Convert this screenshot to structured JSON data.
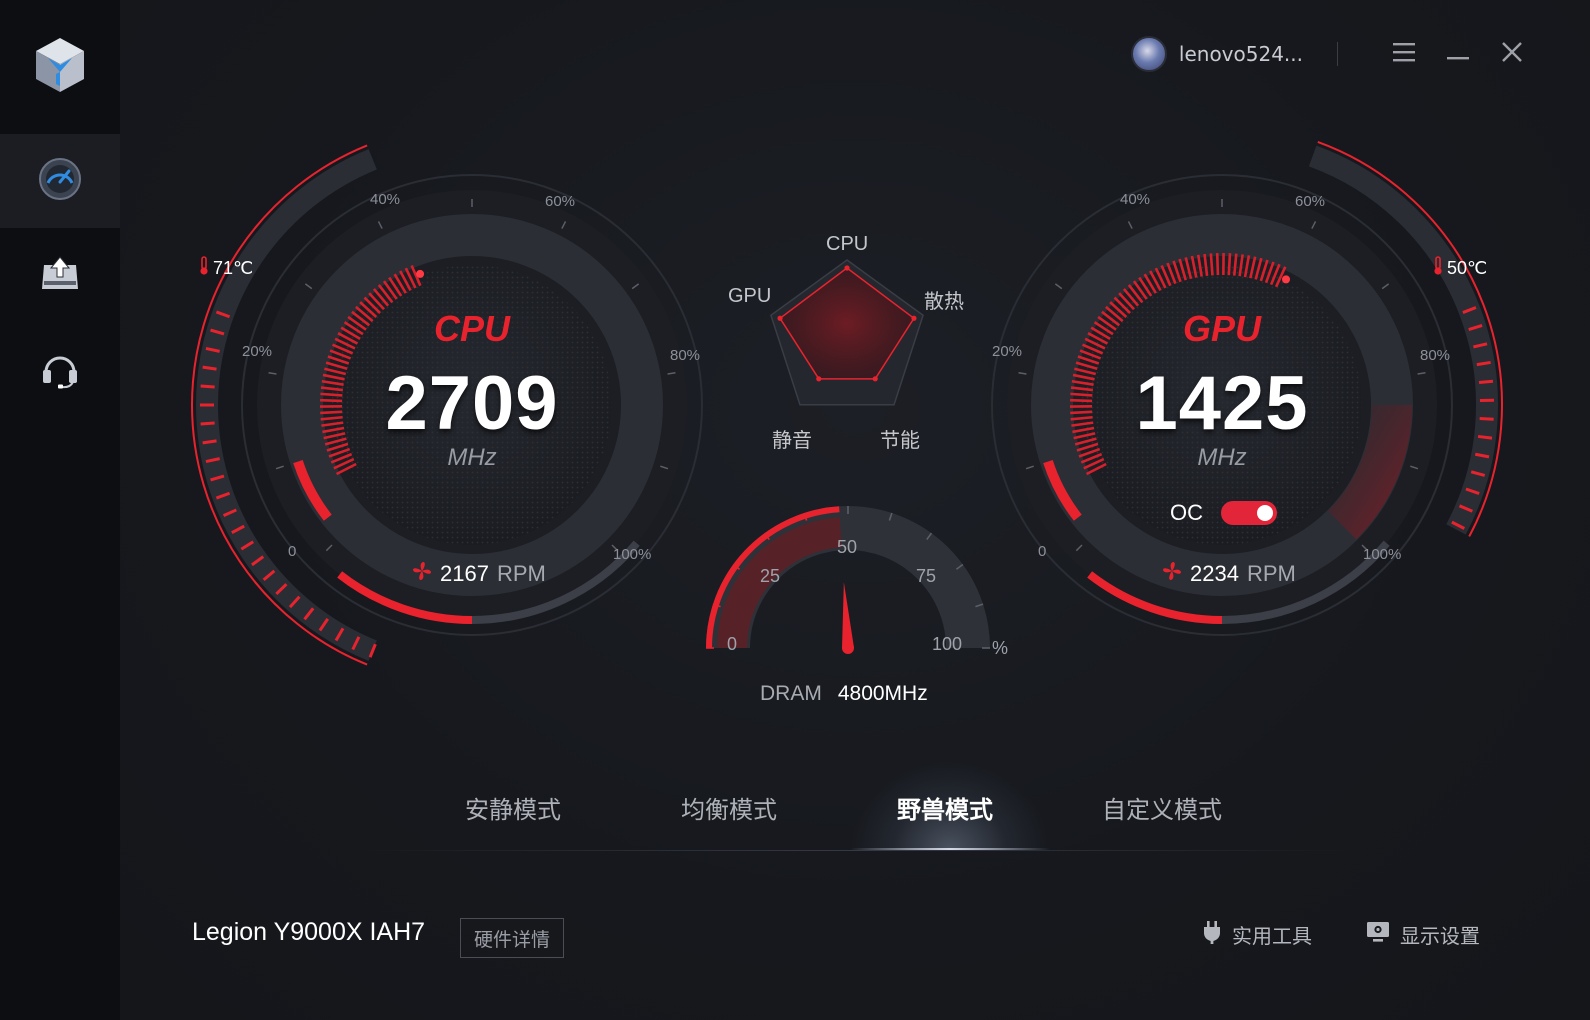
{
  "app": {
    "brand_color": "#e8232e"
  },
  "header": {
    "username": "lenovo524...",
    "avatar_icon": "user-avatar-icon"
  },
  "sidebar": {
    "items": [
      {
        "icon": "speedometer-icon",
        "active": true
      },
      {
        "icon": "update-upload-icon",
        "active": false
      },
      {
        "icon": "headset-support-icon",
        "active": false
      }
    ]
  },
  "cpu": {
    "title": "CPU",
    "value": "2709",
    "unit": "MHz",
    "temperature": "71℃",
    "fan_rpm": "2167",
    "fan_unit": "RPM",
    "usage_fraction": 0.42,
    "ticks": [
      "0",
      "20%",
      "40%",
      "60%",
      "80%",
      "100%"
    ]
  },
  "gpu": {
    "title": "GPU",
    "value": "1425",
    "unit": "MHz",
    "temperature": "50℃",
    "fan_rpm": "2234",
    "fan_unit": "RPM",
    "usage_fraction": 0.6,
    "oc_label": "OC",
    "oc_enabled": true,
    "ticks": [
      "0",
      "20%",
      "40%",
      "60%",
      "80%",
      "100%"
    ]
  },
  "radar": {
    "labels": {
      "top": "CPU",
      "right": "散热",
      "bottom_right": "节能",
      "bottom_left": "静音",
      "left": "GPU"
    }
  },
  "dram": {
    "label": "DRAM",
    "value": "4800MHz",
    "usage_percent": 48,
    "ticks": [
      "0",
      "25",
      "50",
      "75",
      "100"
    ],
    "unit": "%"
  },
  "modes": {
    "items": [
      "安静模式",
      "均衡模式",
      "野兽模式",
      "自定义模式"
    ],
    "active": "野兽模式"
  },
  "footer": {
    "model": "Legion Y9000X IAH7",
    "hw_details_label": "硬件详情",
    "tools_label": "实用工具",
    "display_label": "显示设置"
  }
}
